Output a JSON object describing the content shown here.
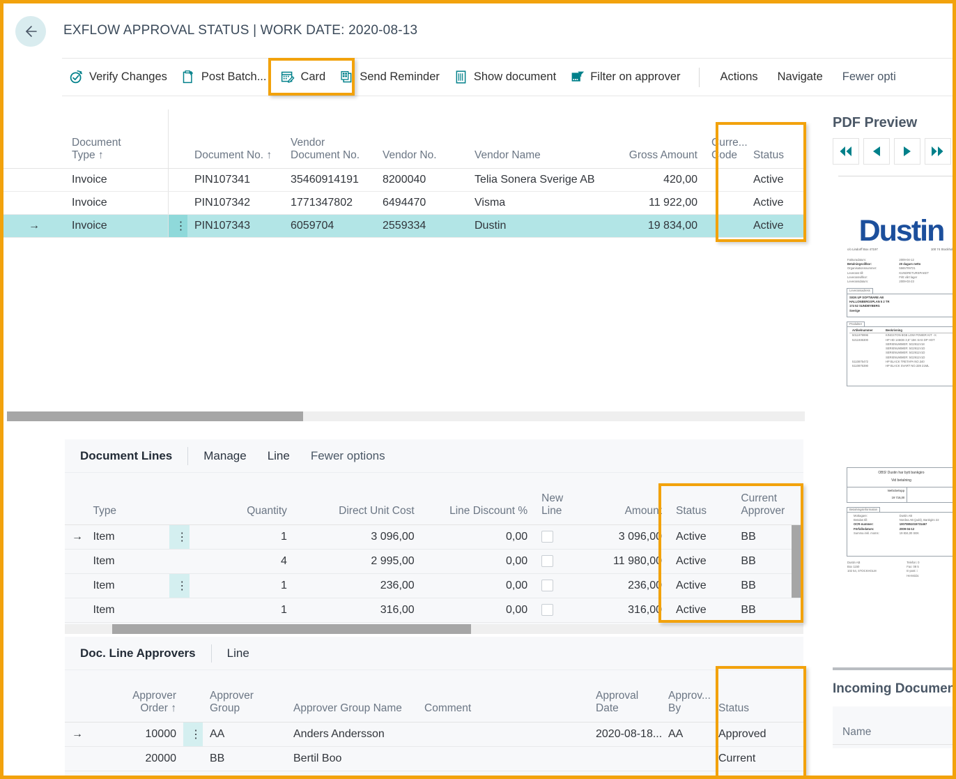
{
  "header": {
    "title": "EXFLOW APPROVAL STATUS | WORK DATE: 2020-08-13",
    "back_icon": "arrow-left-icon"
  },
  "ribbon": {
    "items": [
      {
        "label": "Verify Changes",
        "icon": "verify-changes-icon"
      },
      {
        "label": "Post Batch...",
        "icon": "post-batch-icon"
      },
      {
        "label": "Card",
        "icon": "card-icon",
        "highlighted": true
      },
      {
        "label": "Send Reminder",
        "icon": "send-reminder-icon"
      },
      {
        "label": "Show document",
        "icon": "show-document-icon"
      },
      {
        "label": "Filter on approver",
        "icon": "filter-on-approver-icon"
      }
    ],
    "menus": [
      {
        "label": "Actions"
      },
      {
        "label": "Navigate"
      },
      {
        "label": "Fewer opti"
      }
    ]
  },
  "approval_grid": {
    "columns": [
      {
        "key": "arrow",
        "label": ""
      },
      {
        "key": "document_type",
        "label": "Document\nType ↑"
      },
      {
        "key": "dots",
        "label": ""
      },
      {
        "key": "document_no",
        "label": "Document No. ↑"
      },
      {
        "key": "vendor_document_no",
        "label": "Vendor\nDocument No."
      },
      {
        "key": "vendor_no",
        "label": "Vendor No."
      },
      {
        "key": "vendor_name",
        "label": "Vendor Name"
      },
      {
        "key": "gross_amount",
        "label": "Gross Amount"
      },
      {
        "key": "currency_code",
        "label": "Curre...\nCode"
      },
      {
        "key": "status",
        "label": "Status"
      }
    ],
    "rows": [
      {
        "arrow": "",
        "document_type": "Invoice",
        "dots": "",
        "document_no": "PIN107341",
        "vendor_document_no": "35460914191",
        "vendor_no": "8200040",
        "vendor_name": "Telia Sonera Sverige AB",
        "gross_amount": "420,00",
        "currency_code": "",
        "status": "Active",
        "selected": false
      },
      {
        "arrow": "",
        "document_type": "Invoice",
        "dots": "",
        "document_no": "PIN107342",
        "vendor_document_no": "1771347802",
        "vendor_no": "6494470",
        "vendor_name": "Visma",
        "gross_amount": "11 922,00",
        "currency_code": "",
        "status": "Active",
        "selected": false
      },
      {
        "arrow": "→",
        "document_type": "Invoice",
        "dots": "⋮",
        "document_no": "PIN107343",
        "vendor_document_no": "6059704",
        "vendor_no": "2559334",
        "vendor_name": "Dustin",
        "gross_amount": "19 834,00",
        "currency_code": "",
        "status": "Active",
        "selected": true
      }
    ]
  },
  "document_lines": {
    "title": "Document Lines",
    "actions": [
      "Manage",
      "Line",
      "Fewer options"
    ],
    "columns": [
      {
        "key": "arrow",
        "label": ""
      },
      {
        "key": "type",
        "label": "Type"
      },
      {
        "key": "dots",
        "label": ""
      },
      {
        "key": "quantity",
        "label": "Quantity"
      },
      {
        "key": "direct_unit_cost",
        "label": "Direct Unit Cost"
      },
      {
        "key": "line_discount_pct",
        "label": "Line Discount %"
      },
      {
        "key": "new_line",
        "label": "New\nLine"
      },
      {
        "key": "amount",
        "label": "Amount"
      },
      {
        "key": "status",
        "label": "Status"
      },
      {
        "key": "current_approver",
        "label": "Current\nApprover"
      }
    ],
    "rows": [
      {
        "arrow": "→",
        "type": "Item",
        "dots": "⋮",
        "quantity": "1",
        "direct_unit_cost": "3 096,00",
        "line_discount_pct": "0,00",
        "new_line": false,
        "amount": "3 096,00",
        "status": "Active",
        "current_approver": "BB"
      },
      {
        "arrow": "",
        "type": "Item",
        "dots": "",
        "quantity": "4",
        "direct_unit_cost": "2 995,00",
        "line_discount_pct": "0,00",
        "new_line": false,
        "amount": "11 980,00",
        "status": "Active",
        "current_approver": "BB"
      },
      {
        "arrow": "",
        "type": "Item",
        "dots": "⋮",
        "quantity": "1",
        "direct_unit_cost": "236,00",
        "line_discount_pct": "0,00",
        "new_line": false,
        "amount": "236,00",
        "status": "Active",
        "current_approver": "BB"
      },
      {
        "arrow": "",
        "type": "Item",
        "dots": "",
        "quantity": "1",
        "direct_unit_cost": "316,00",
        "line_discount_pct": "0,00",
        "new_line": false,
        "amount": "316,00",
        "status": "Active",
        "current_approver": "BB"
      }
    ]
  },
  "doc_line_approvers": {
    "title": "Doc. Line Approvers",
    "actions": [
      "Line"
    ],
    "columns": [
      {
        "key": "arrow",
        "label": ""
      },
      {
        "key": "approver_order",
        "label": "Approver\nOrder ↑"
      },
      {
        "key": "dots",
        "label": ""
      },
      {
        "key": "approver_group",
        "label": "Approver\nGroup"
      },
      {
        "key": "approver_group_name",
        "label": "Approver Group Name"
      },
      {
        "key": "comment",
        "label": "Comment"
      },
      {
        "key": "approval_date",
        "label": "Approval\nDate"
      },
      {
        "key": "approved_by",
        "label": "Approv...\nBy"
      },
      {
        "key": "status",
        "label": "Status"
      }
    ],
    "rows": [
      {
        "arrow": "→",
        "approver_order": "10000",
        "dots": "⋮",
        "approver_group": "AA",
        "approver_group_name": "Anders Andersson",
        "comment": "",
        "approval_date": "2020-08-18...",
        "approved_by": "AA",
        "status": "Approved"
      },
      {
        "arrow": "",
        "approver_order": "20000",
        "dots": "",
        "approver_group": "BB",
        "approver_group_name": "Bertil Boo",
        "comment": "",
        "approval_date": "",
        "approved_by": "",
        "status": "Current"
      }
    ]
  },
  "pdf_preview": {
    "title": "PDF Preview",
    "nav": [
      {
        "name": "first-page-button",
        "glyph": "◀◀"
      },
      {
        "name": "previous-page-button",
        "glyph": "◀"
      },
      {
        "name": "next-page-button",
        "glyph": "▶"
      },
      {
        "name": "last-page-button",
        "glyph": "▶▶"
      }
    ],
    "document": {
      "logo_text": "Dustin",
      "address_left": "c/o Lindorff Box 47197",
      "address_right": "100 74 Stockholm",
      "fields": [
        {
          "label": "Fakturadatum:",
          "value": "2009-04-12",
          "bold": false
        },
        {
          "label": "Betalningsvillkor:",
          "value": "20 dagars netto",
          "bold": true
        },
        {
          "label": "Organisationsnummer:",
          "value": "5565709721",
          "bold": false
        },
        {
          "label": "Leverans till:",
          "value": "KUNDRETURSPAKET",
          "bold": false
        },
        {
          "label": "Leveransvillkor:",
          "value": "Fritt vårt lager",
          "bold": false
        },
        {
          "label": "Leveransdatum:",
          "value": "2009-03-23",
          "bold": false
        }
      ],
      "address_tab": "Leveransadress",
      "address_block": [
        "SIGN UP SOFTWARE AB",
        "HALLONBERGSPLAN 5 2 TR",
        "174 52 SUNDBYBERG",
        "Sverige"
      ],
      "products_tab": "Produkter",
      "products_header": {
        "c1": "Artikelnummer",
        "c2": "Beskrivning"
      },
      "products": [
        {
          "c1": "5011979996",
          "c2": "KINGSTON 8GB LOW POWER KIT - K"
        },
        {
          "c1": "5211936300",
          "c2": "HP HD 146GB 3,5\" 15K SAS DP HOT"
        },
        {
          "c1": "",
          "c2": "SERIENUMMER:          5G2911V18"
        },
        {
          "c1": "",
          "c2": "SERIENUMMER:          5G2911V1D"
        },
        {
          "c1": "",
          "c2": "SERIENUMMER:          5G2911V1D"
        },
        {
          "c1": "",
          "c2": "SERIENUMMER:          5G2911V1D"
        },
        {
          "c1": "5110875472",
          "c2": "HP BLACK TRETAPA NO.340"
        },
        {
          "c1": "5110875390",
          "c2": "HP BLACK SVART NO.339 21ML"
        }
      ],
      "obs_line1": "OBS! Dustin har bytt bankgiro",
      "obs_line2": "Vid betalning",
      "netto_label": "Nettobelopp",
      "netto_value": "19 716,00",
      "payment_tab": "Betalningsinformation",
      "payment_fields": [
        {
          "label": "Mottagare:",
          "value": "Dustin AB",
          "bold": false
        },
        {
          "label": "Betalas till:",
          "value": "Nordea AB (publ), Bankgiro 22",
          "bold": false
        },
        {
          "label": "OCR-nummer:",
          "value": "10070851015731467",
          "bold": true
        },
        {
          "label": "Förfallodatum:",
          "value": "2009-04-12",
          "bold": true
        },
        {
          "label": "Summa inkl. moms:",
          "value": "19 834,00 SEK",
          "bold": false
        }
      ],
      "footer_left": [
        "Dustin AB",
        "Box 1150",
        "102 54, STOCKHOLM"
      ],
      "footer_right": [
        "Telefon: 0",
        "Fax: 08 5",
        "E-post: i",
        "Hemsida:"
      ]
    }
  },
  "incoming_documents": {
    "title": "Incoming Documen",
    "columns": [
      "Name"
    ]
  },
  "colors": {
    "accent_orange": "#F2A20C",
    "link_teal": "#0f6b72",
    "selection_cyan": "#b2e5e6",
    "icon_teal": "#00808a",
    "header_text": "#3b4a5a"
  }
}
